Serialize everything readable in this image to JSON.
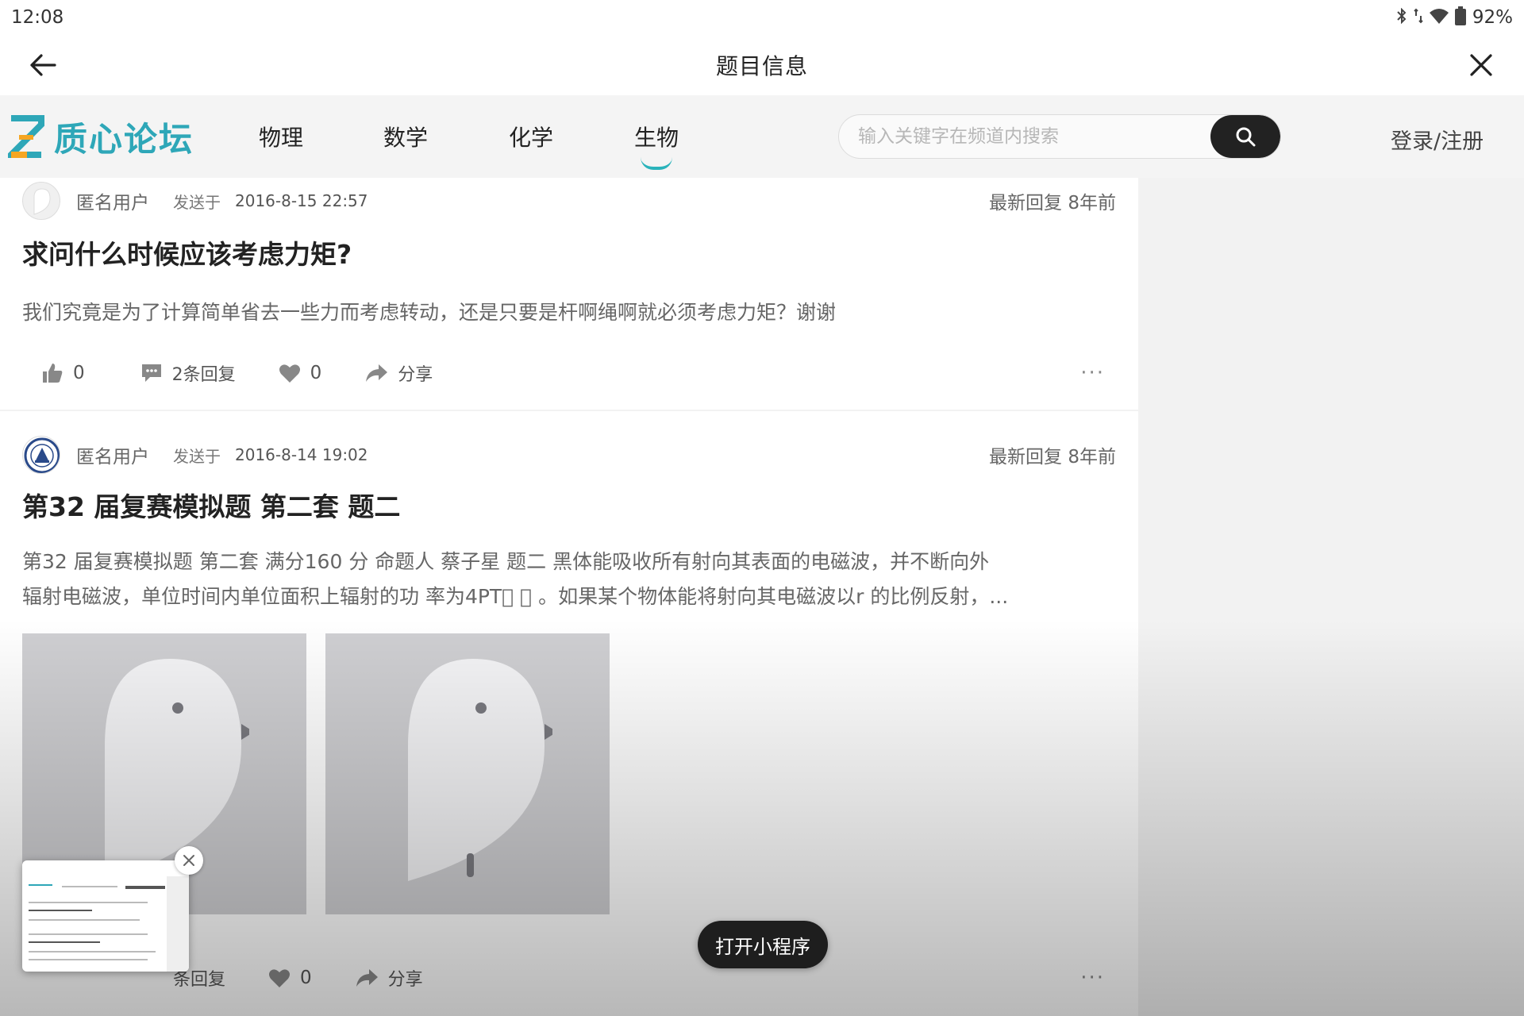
{
  "status_bar": {
    "time": "12:08",
    "battery": "92%",
    "icons": [
      "bluetooth-icon",
      "signal-icon",
      "wifi-icon",
      "battery-icon"
    ]
  },
  "title_bar": {
    "title": "题目信息",
    "back_icon": "arrow-left-icon",
    "close_icon": "close-icon"
  },
  "site": {
    "logo_text": "质心论坛",
    "nav": [
      {
        "label": "物理",
        "active": false
      },
      {
        "label": "数学",
        "active": false
      },
      {
        "label": "化学",
        "active": false
      },
      {
        "label": "生物",
        "active": true
      }
    ],
    "search": {
      "placeholder": "输入关键字在频道内搜索",
      "value": ""
    },
    "login_label": "登录/注册"
  },
  "posts": [
    {
      "user": "匿名用户",
      "sent_label": "发送于",
      "date": "2016-8-15 22:57",
      "latest_reply": "最新回复 8年前",
      "title": "求问什么时候应该考虑力矩?",
      "excerpt": "我们究竟是为了计算简单省去一些力而考虑转动，还是只要是杆啊绳啊就必须考虑力矩？谢谢",
      "likes": "0",
      "replies": "2条回复",
      "favorites": "0",
      "share": "分享",
      "more": "···"
    },
    {
      "user": "匿名用户",
      "sent_label": "发送于",
      "date": "2016-8-14 19:02",
      "latest_reply": "最新回复 8年前",
      "title": "第32 届复赛模拟题 第二套 题二",
      "excerpt_line1": "第32 届复赛模拟题 第二套 满分160 分 命题人 蔡子星 题二 黑体能吸收所有射向其表面的电磁波，并不断向外",
      "excerpt_line2": "辐射电磁波，单位时间内单位面积上辐射的功 率为4PT⃞ ⃞ 。如果某个物体能将射向其电磁波以r 的比例反射，...",
      "replies": "条回复",
      "favorites": "0",
      "share": "分享",
      "more": "···"
    }
  ],
  "mini_program_button": "打开小程序",
  "colors": {
    "accent": "#2ab3bb",
    "logo": "#2ea7b8",
    "dark_button": "#1e1e1e"
  }
}
